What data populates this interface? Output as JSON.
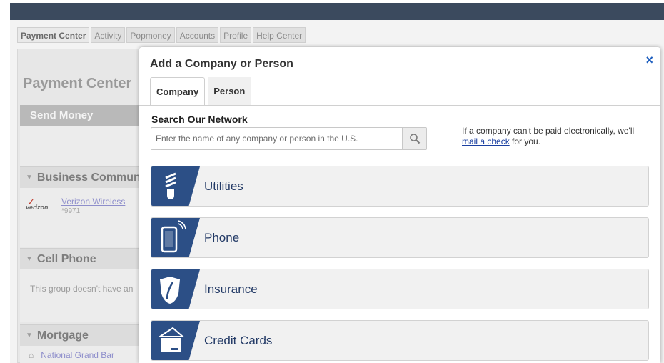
{
  "nav": {
    "tabs": [
      "Payment Center",
      "Activity",
      "Popmoney",
      "Accounts",
      "Profile",
      "Help Center"
    ]
  },
  "background": {
    "title": "Payment Center",
    "send_money": "Send Money",
    "groups": [
      {
        "title": "Business Communi"
      },
      {
        "title": "Cell Phone"
      },
      {
        "title": "Mortgage"
      }
    ],
    "verizon": {
      "logo": "verizon",
      "name": "Verizon Wireless",
      "sub": "*9971"
    },
    "cell_empty": "This group doesn't have an",
    "mortgage_item": "National Grand Bar"
  },
  "modal": {
    "title": "Add a Company or Person",
    "close": "×",
    "tabs": [
      "Company",
      "Person"
    ],
    "search_label": "Search Our Network",
    "search_placeholder": "Enter the name of any company or person in the U.S.",
    "note_prefix": "If a company can't be paid electronically, we'll",
    "note_link": "mail a check",
    "note_suffix": " for you.",
    "categories": [
      {
        "label": "Utilities",
        "icon": "lightbulb-icon"
      },
      {
        "label": "Phone",
        "icon": "mobile-phone-icon"
      },
      {
        "label": "Insurance",
        "icon": "shield-leaf-icon"
      },
      {
        "label": "Credit Cards",
        "icon": "credit-card-icon"
      }
    ]
  },
  "colors": {
    "badge": "#2c4f86",
    "modal_close": "#1f5fbf",
    "link": "#1a3fa0"
  }
}
